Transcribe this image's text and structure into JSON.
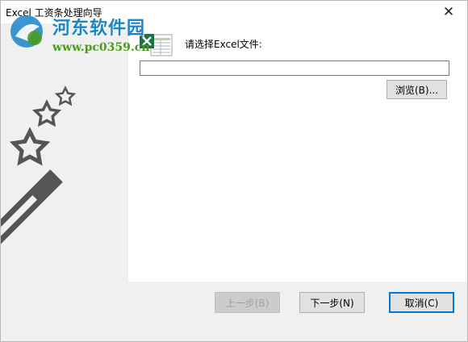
{
  "window": {
    "title": "Excel 工资条处理向导",
    "close_glyph": "✕"
  },
  "watermark": {
    "site_name": "河东软件园",
    "url": "www.pc0359.cn"
  },
  "main": {
    "prompt": "请选择Excel文件:",
    "file_path_value": "",
    "browse_label": "浏览(B)..."
  },
  "footer": {
    "back_label": "上一步(B)",
    "next_label": "下一步(N)",
    "cancel_label": "取消(C)"
  },
  "icons": {
    "banner": [
      "star-icon",
      "magic-wand-icon"
    ],
    "excel": "excel-file-icon",
    "watermark": "watermark-logo-icon"
  },
  "colors": {
    "accent": "#0078d7",
    "banner_art": "#555555",
    "excel_green": "#1e7145"
  }
}
